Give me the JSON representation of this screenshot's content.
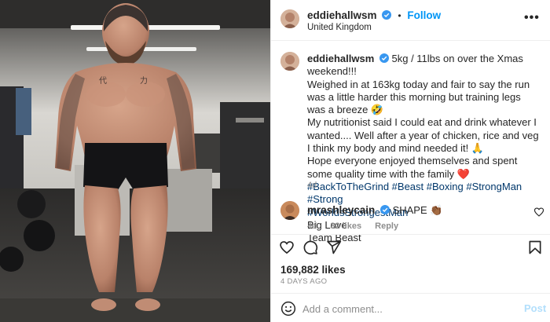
{
  "post": {
    "username": "eddiehallwsm",
    "follow_label": "Follow",
    "location": "United Kingdom",
    "more_label": "•••",
    "caption_lines": [
      "5kg / 11lbs on over the Xmas weekend!!!",
      "Weighed in at 163kg today and fair to say the run was a little harder this morning but training legs was a breeze 🤣",
      "My nutritionist said I could eat and drink whatever I wanted.... Well after a year of chicken, rice and veg I think my body and mind needed it! 🙏",
      "Hope everyone enjoyed themselves and spent some quality time with the family ❤️"
    ],
    "hashtags_1": "#BackToTheGrind #Beast #Boxing #StrongMan #Strong",
    "hashtags_2": "#WorldsStrongestMan",
    "signoff_1": "Big Love",
    "signoff_2": "Team Beast",
    "caption_time": "4d",
    "likes": "169,882 likes",
    "posted_ago": "4 DAYS AGO"
  },
  "comment": {
    "username": "mrashleycain",
    "text": "SHAPE 👏🏾",
    "time": "4d",
    "likes": "32 likes",
    "reply_label": "Reply"
  },
  "add_comment": {
    "placeholder": "Add a comment...",
    "post_label": "Post"
  },
  "colors": {
    "accent": "#0095f6",
    "hashtag": "#00376b",
    "muted": "#8e8e8e",
    "post_disabled": "#b2dffc"
  },
  "icons": [
    "verified-badge-icon",
    "heart-icon",
    "comment-icon",
    "share-icon",
    "bookmark-icon",
    "emoji-icon",
    "more-options-icon"
  ]
}
